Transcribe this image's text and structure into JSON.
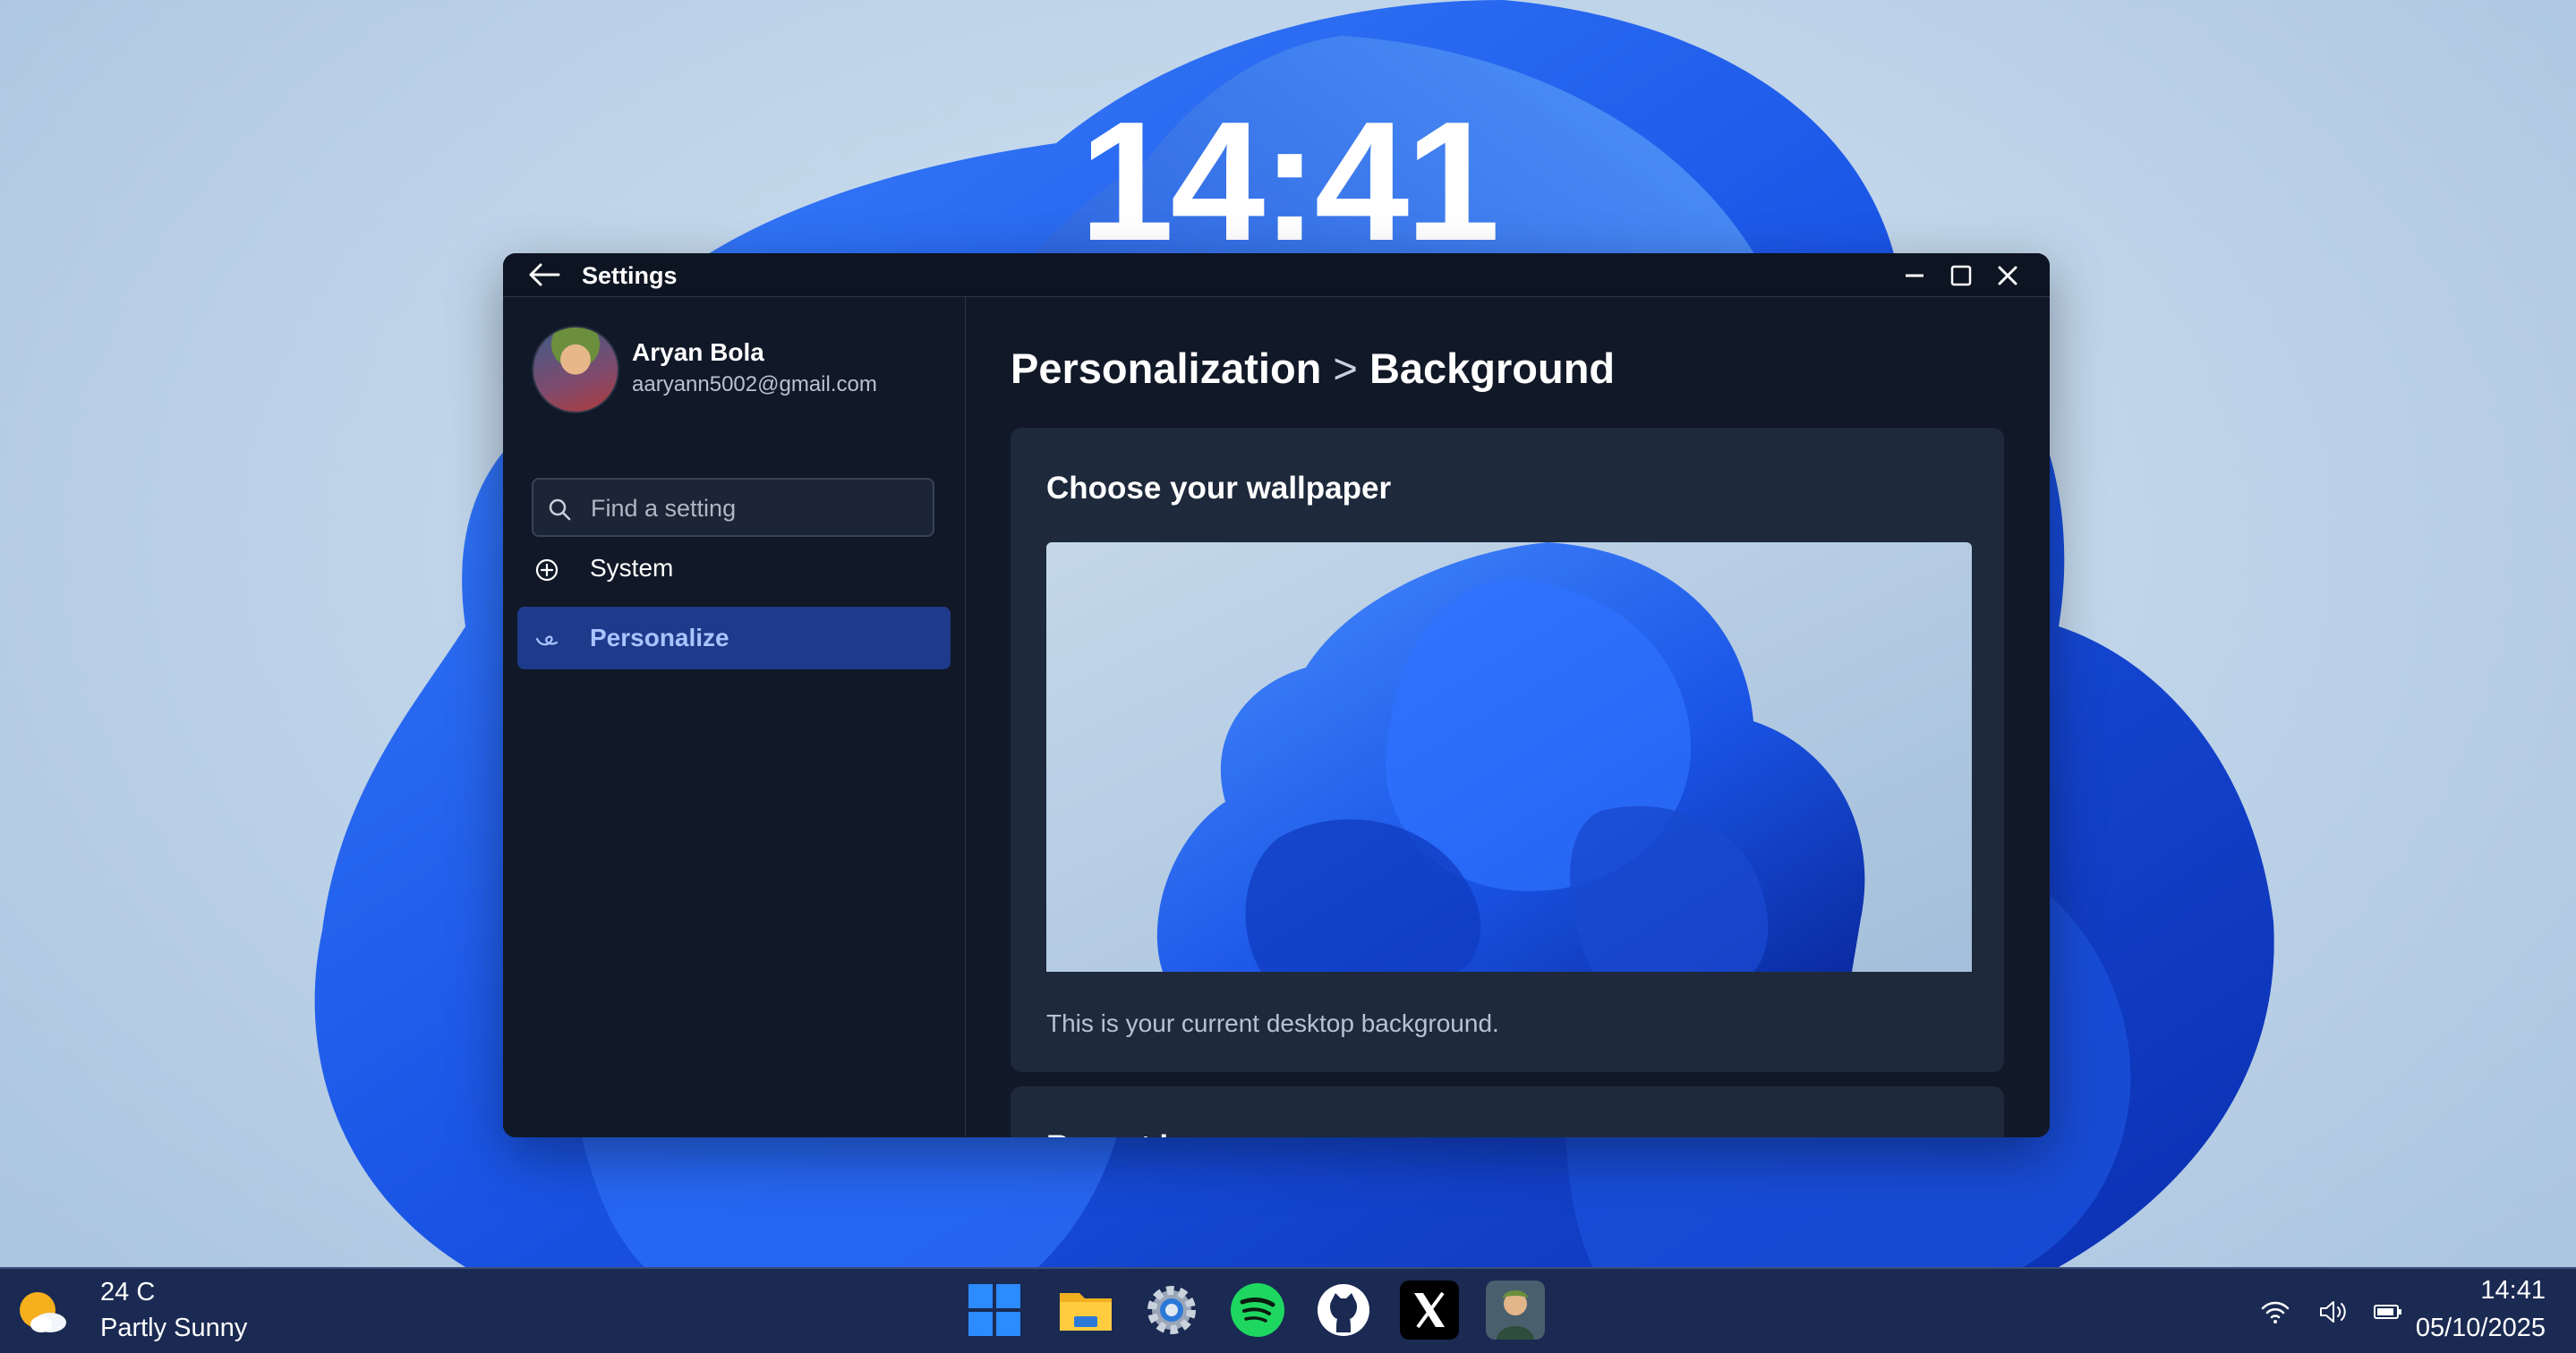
{
  "desktop": {
    "lock_clock": "14:41",
    "wallpaper": "windows-11-bloom-blue"
  },
  "window": {
    "title": "Settings",
    "controls": {
      "minimize": "minimize-icon",
      "maximize": "maximize-icon",
      "close": "close-icon"
    }
  },
  "sidebar": {
    "user": {
      "name": "Aryan Bola",
      "email": "aaryann5002@gmail.com"
    },
    "search": {
      "placeholder": "Find a setting",
      "value": ""
    },
    "items": [
      {
        "label": "System",
        "icon": "system-icon",
        "active": false
      },
      {
        "label": "Personalize",
        "icon": "personalize-icon",
        "active": true
      }
    ]
  },
  "content": {
    "breadcrumb": {
      "section": "Personalization",
      "separator": ">",
      "page": "Background"
    },
    "wallpaper_card": {
      "title": "Choose your wallpaper",
      "description": "This is your current desktop background."
    },
    "next_card_title": "Recent images"
  },
  "taskbar": {
    "weather": {
      "temp": "24 C",
      "condition": "Partly Sunny",
      "icon": "partly-sunny-icon"
    },
    "apps": [
      "start-icon",
      "file-explorer-icon",
      "settings-icon",
      "spotify-icon",
      "github-icon",
      "x-icon",
      "profile-app-icon"
    ],
    "tray": [
      "wifi-icon",
      "volume-icon",
      "battery-icon"
    ],
    "clock": {
      "time": "14:41",
      "date": "05/10/2025"
    }
  },
  "colors": {
    "accent": "#1e3a8a",
    "accent_text": "#a9c4ff",
    "window_bg": "#111827",
    "card_bg": "#1e293b",
    "taskbar_bg": "#1a2a52",
    "bloom_blue": "#1f5ae8"
  }
}
